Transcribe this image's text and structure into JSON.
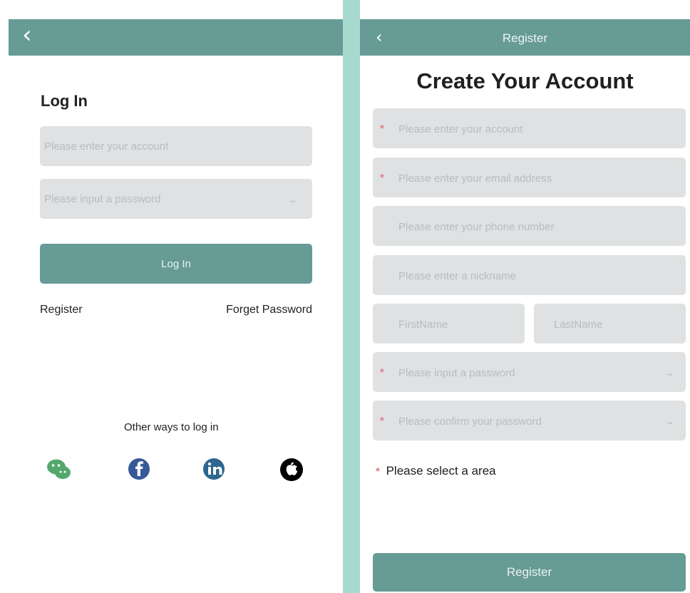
{
  "login": {
    "back_icon": "chevron-left-icon",
    "title": "Log In",
    "account_placeholder": "Please enter your account",
    "password_placeholder": "Please input a password",
    "eye_icon": "eye-closed-icon",
    "button_label": "Log In",
    "register_link": "Register",
    "forget_link": "Forget Password",
    "other_ways": "Other ways to log in",
    "social": [
      "wechat-icon",
      "facebook-icon",
      "linkedin-icon",
      "apple-icon"
    ]
  },
  "register": {
    "back_icon": "chevron-left-icon",
    "header_title": "Register",
    "title": "Create Your Account",
    "required_mark": "*",
    "fields": {
      "account": "Please enter your account",
      "email": "Please enter your email address",
      "phone": "Please enter your phone number",
      "nickname": "Please enter a nickname",
      "first_name": "FirstName",
      "last_name": "LastName",
      "password": "Please input a password",
      "confirm_password": "Please confirm your password"
    },
    "area_label": "Please select a area",
    "button_label": "Register"
  },
  "colors": {
    "header": "#679b95",
    "field": "#dfe1e2",
    "divider": "#a8d9cf",
    "required": "#e47e86"
  }
}
